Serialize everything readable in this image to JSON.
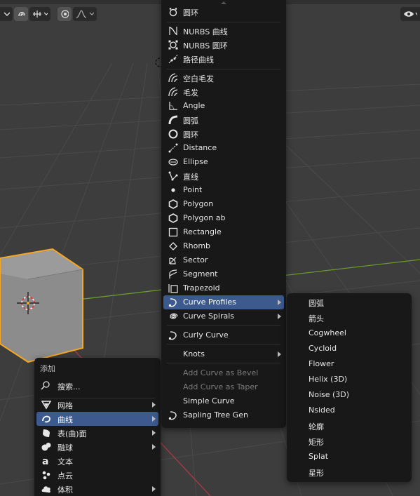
{
  "add_menu": {
    "title": "添加",
    "search_label": "搜索...",
    "items": [
      {
        "label": "网格",
        "icon": "mesh-icon",
        "submenu": true
      },
      {
        "label": "曲线",
        "icon": "curve-icon",
        "submenu": true,
        "highlighted": true
      },
      {
        "label": "表(曲)面",
        "icon": "surface-icon",
        "submenu": true
      },
      {
        "label": "融球",
        "icon": "metaball-icon",
        "submenu": true
      },
      {
        "label": "文本",
        "icon": "text-icon",
        "submenu": false
      },
      {
        "label": "点云",
        "icon": "pointcloud-icon",
        "submenu": false
      },
      {
        "label": "体积",
        "icon": "volume-icon",
        "submenu": true
      }
    ]
  },
  "curve_menu": {
    "items": [
      {
        "label": "圆环",
        "icon": "bezier-circle-icon"
      },
      {
        "label": "NURBS 曲线",
        "icon": "nurbs-curve-icon"
      },
      {
        "label": "NURBS 圆环",
        "icon": "nurbs-circle-icon"
      },
      {
        "label": "路径曲线",
        "icon": "path-curve-icon"
      },
      {
        "label": "空白毛发",
        "icon": "hair-empty-icon"
      },
      {
        "label": "毛发",
        "icon": "hair-icon"
      },
      {
        "label": "Angle",
        "icon": "angle-icon"
      },
      {
        "label": "圆弧",
        "icon": "arc-icon"
      },
      {
        "label": "圆环",
        "icon": "circle-icon"
      },
      {
        "label": "Distance",
        "icon": "distance-icon"
      },
      {
        "label": "Ellipse",
        "icon": "ellipse-icon"
      },
      {
        "label": "直线",
        "icon": "line-icon"
      },
      {
        "label": "Point",
        "icon": "point-icon"
      },
      {
        "label": "Polygon",
        "icon": "polygon-icon"
      },
      {
        "label": "Polygon ab",
        "icon": "polygon-ab-icon"
      },
      {
        "label": "Rectangle",
        "icon": "rectangle-icon"
      },
      {
        "label": "Rhomb",
        "icon": "rhomb-icon"
      },
      {
        "label": "Sector",
        "icon": "sector-icon"
      },
      {
        "label": "Segment",
        "icon": "segment-icon"
      },
      {
        "label": "Trapezoid",
        "icon": "trapezoid-icon"
      },
      {
        "label": "Curve Profiles",
        "icon": "curve-profile-icon",
        "submenu": true,
        "highlighted": true
      },
      {
        "label": "Curve Spirals",
        "icon": "spiral-icon",
        "submenu": true
      },
      {
        "label": "Curly Curve",
        "icon": "curly-curve-icon"
      },
      {
        "label": "Knots",
        "icon": "knots-icon",
        "submenu": true
      },
      {
        "label": "Add Curve as Bevel",
        "disabled": true
      },
      {
        "label": "Add Curve as Taper",
        "disabled": true
      },
      {
        "label": "Simple Curve"
      },
      {
        "label": "Sapling Tree Gen",
        "icon": "curve-profile-icon"
      }
    ]
  },
  "profiles_menu": {
    "items": [
      "圆弧",
      "箭头",
      "Cogwheel",
      "Cycloid",
      "Flower",
      "Helix (3D)",
      "Noise (3D)",
      "Nsided",
      "轮廓",
      "矩形",
      "Splat",
      "星形"
    ]
  },
  "colors": {
    "viewport_bg": "#3d3d3d",
    "menu_bg": "#181818",
    "highlight": "#3d5a8f",
    "cube_outline": "#f5a623",
    "x_axis": "#a8394a",
    "y_axis": "#6a9a2a"
  }
}
